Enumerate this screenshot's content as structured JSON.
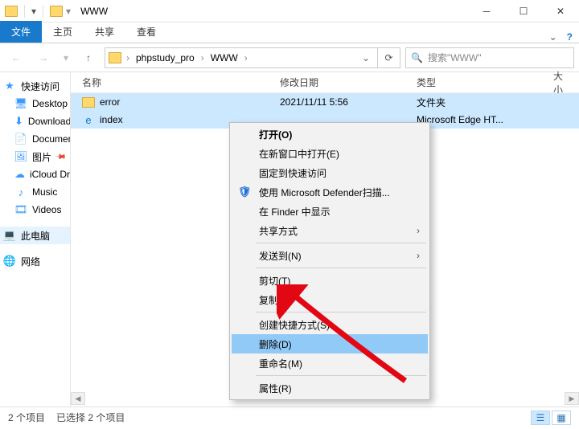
{
  "titlebar": {
    "title": "WWW"
  },
  "ribbon": {
    "file": "文件",
    "home": "主页",
    "share": "共享",
    "view": "查看"
  },
  "breadcrumb": {
    "p1": "phpstudy_pro",
    "p2": "WWW"
  },
  "search": {
    "placeholder": "搜索\"WWW\""
  },
  "sidebar": {
    "quick": "快速访问",
    "desktop": "Desktop",
    "downloads": "Downloads",
    "documents": "Documents",
    "pictures": "图片",
    "icloud": "iCloud Drive (M",
    "music": "Music",
    "videos": "Videos",
    "thispc": "此电脑",
    "network": "网络"
  },
  "columns": {
    "name": "名称",
    "date": "修改日期",
    "type": "类型",
    "size": "大小"
  },
  "rows": [
    {
      "name": "error",
      "date": "2021/11/11 5:56",
      "type": "文件夹",
      "icon": "folder"
    },
    {
      "name": "index",
      "date": "",
      "type": "Microsoft Edge HT...",
      "icon": "edge"
    }
  ],
  "ctx": {
    "open": "打开(O)",
    "openNew": "在新窗口中打开(E)",
    "pin": "固定到快速访问",
    "defender": "使用 Microsoft Defender扫描...",
    "finder": "在 Finder 中显示",
    "share": "共享方式",
    "sendto": "发送到(N)",
    "cut": "剪切(T)",
    "copy": "复制(C)",
    "shortcut": "创建快捷方式(S)",
    "delete": "删除(D)",
    "rename": "重命名(M)",
    "props": "属性(R)"
  },
  "status": {
    "count": "2 个项目",
    "selected": "已选择 2 个项目"
  }
}
